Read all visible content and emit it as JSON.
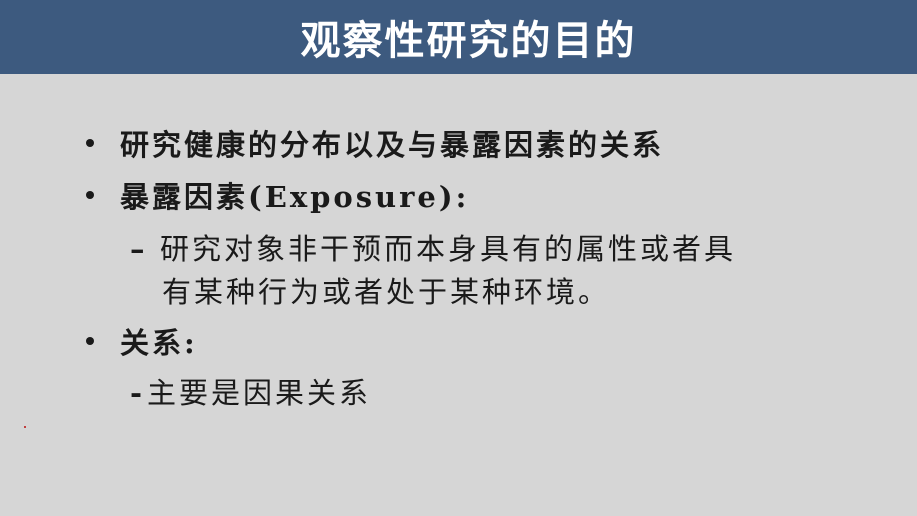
{
  "slide": {
    "title": "观察性研究的目的",
    "bullets": [
      {
        "text": "研究健康的分布以及与暴露因素的关系"
      },
      {
        "text": "暴露因素(Exposure):"
      },
      {
        "text": "关系:"
      }
    ],
    "sub_items": {
      "exposure_dash": "–",
      "exposure_line1": "研究对象非干预而本身具有的属性或者具",
      "exposure_line2": "有某种行为或者处于某种环境。",
      "relation_dash": "-",
      "relation_text": "主要是因果关系"
    }
  },
  "colors": {
    "title_bar": "#3d5a7f",
    "background": "#d6d6d6",
    "text": "#1a1a1a"
  }
}
